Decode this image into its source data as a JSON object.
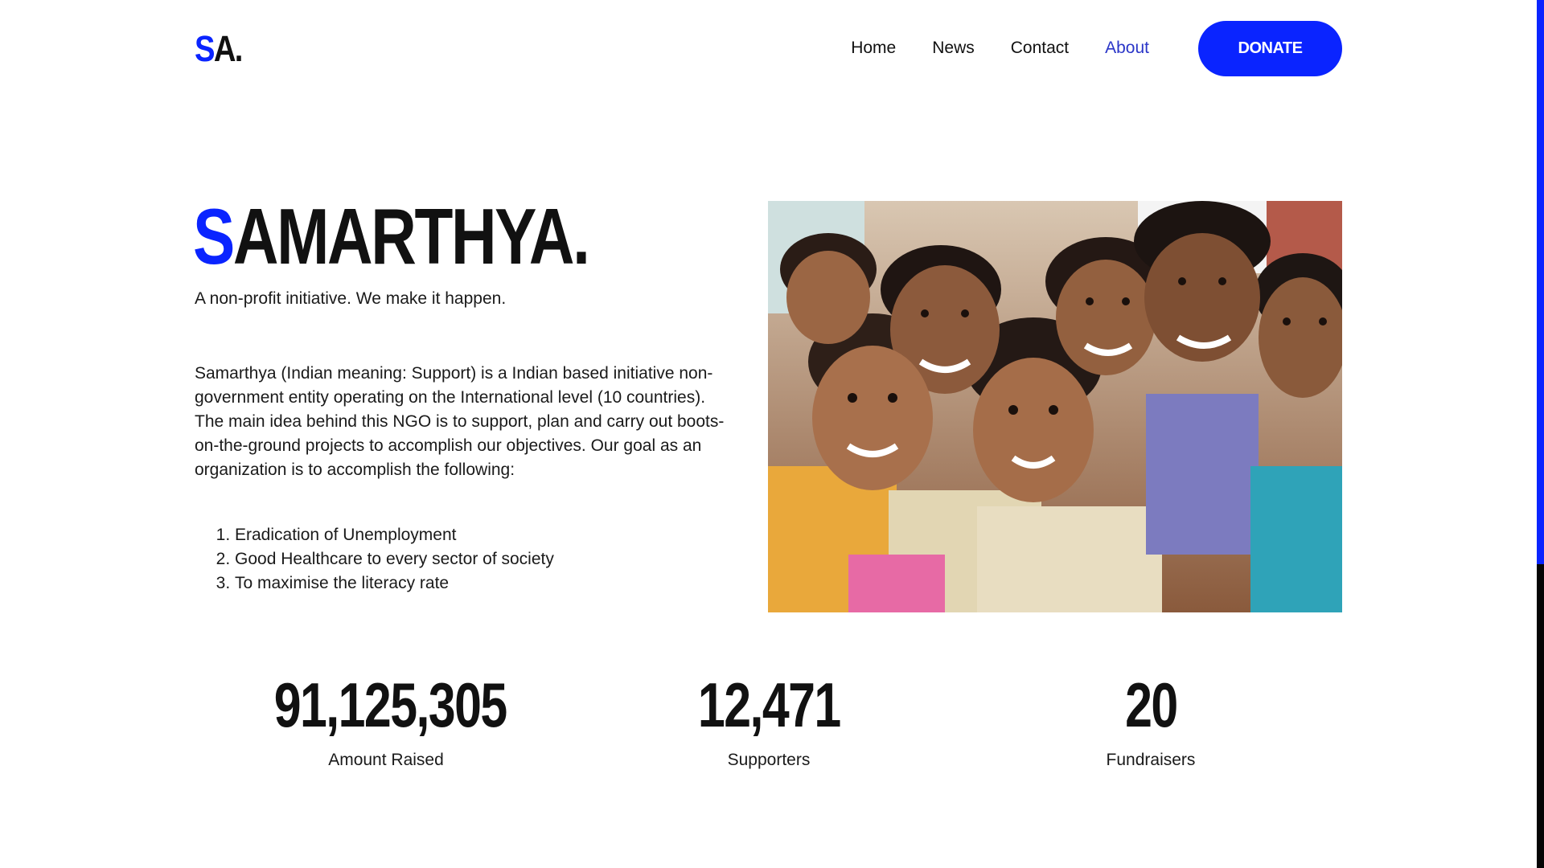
{
  "header": {
    "logo_initial": "S",
    "logo_rest": "A.",
    "nav": [
      {
        "label": "Home",
        "active": false
      },
      {
        "label": "News",
        "active": false
      },
      {
        "label": "Contact",
        "active": false
      },
      {
        "label": "About",
        "active": true
      }
    ],
    "donate_label": "DONATE"
  },
  "hero": {
    "title_initial": "S",
    "title_rest": "AMARTHYA.",
    "tagline": "A non-profit initiative. We make it happen.",
    "description": "Samarthya (Indian meaning: Support) is a Indian based initiative non-government entity operating on the International level (10 countries). The main idea behind this NGO is to support, plan and carry out boots-on-the-ground projects to accomplish our objectives. Our goal as an organization is to accomplish the following:",
    "goals": [
      "Eradication of Unemployment",
      "Good Healthcare to every sector of society",
      "To maximise the literacy rate"
    ]
  },
  "stats": [
    {
      "value": "91,125,305",
      "label": "Amount Raised"
    },
    {
      "value": "12,471",
      "label": "Supporters"
    },
    {
      "value": "20",
      "label": "Fundraisers"
    }
  ],
  "colors": {
    "accent": "#0a24ff",
    "nav_active": "#2b36c8",
    "text": "#111111"
  }
}
